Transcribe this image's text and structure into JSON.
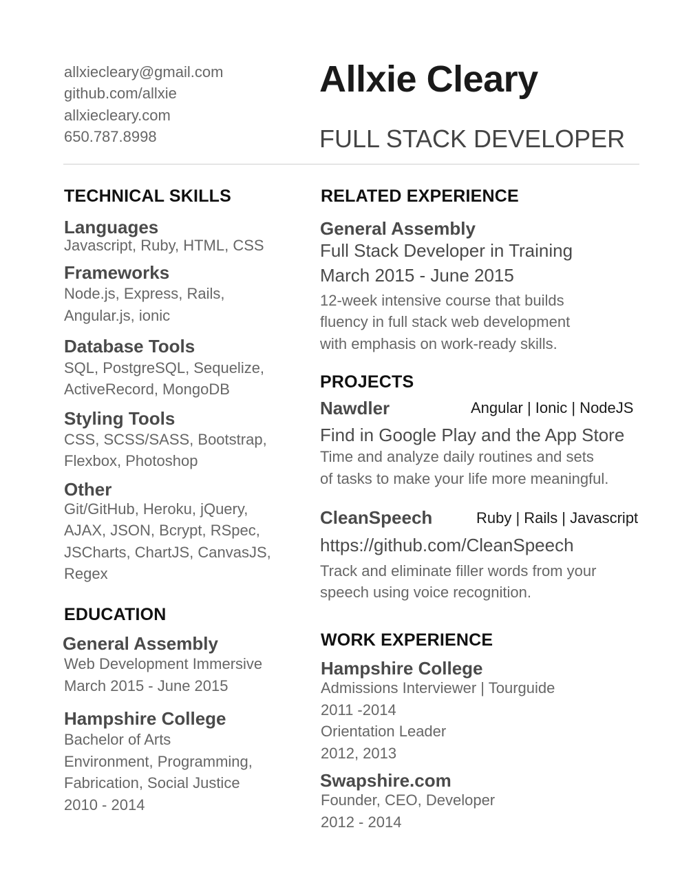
{
  "header": {
    "contact": [
      "allxiecleary@gmail.com",
      "github.com/allxie",
      "allxiecleary.com",
      "650.787.8998"
    ],
    "name": "Allxie Cleary",
    "role": "FULL STACK DEVELOPER"
  },
  "skills": {
    "heading": "TECHNICAL SKILLS",
    "groups": [
      {
        "title": "Languages",
        "lines": [
          "Javascript, Ruby, HTML, CSS"
        ]
      },
      {
        "title": "Frameworks",
        "lines": [
          "Node.js, Express, Rails,",
          "Angular.js, ionic"
        ]
      },
      {
        "title": "Database Tools",
        "lines": [
          "SQL, PostgreSQL, Sequelize,",
          "ActiveRecord, MongoDB"
        ]
      },
      {
        "title": "Styling Tools",
        "lines": [
          "CSS, SCSS/SASS, Bootstrap,",
          "Flexbox, Photoshop"
        ]
      },
      {
        "title": "Other",
        "lines": [
          "Git/GitHub, Heroku, jQuery,",
          "AJAX, JSON, Bcrypt, RSpec,",
          "JSCharts, ChartJS, CanvasJS,",
          "Regex"
        ]
      }
    ]
  },
  "education": {
    "heading": "EDUCATION",
    "entries": [
      {
        "school": "General Assembly",
        "lines": [
          "Web Development Immersive",
          "March 2015 - June 2015"
        ]
      },
      {
        "school": "Hampshire College",
        "lines": [
          "Bachelor of Arts",
          "Environment, Programming,",
          "Fabrication, Social Justice",
          "2010 - 2014"
        ]
      }
    ]
  },
  "related": {
    "heading": "RELATED EXPERIENCE",
    "org": "General Assembly",
    "title": "Full Stack Developer in Training",
    "dates": "March 2015 - June 2015",
    "desc": [
      "12-week intensive course that builds",
      "fluency in full stack web development",
      "with emphasis on work-ready skills."
    ]
  },
  "projects": {
    "heading": "PROJECTS",
    "items": [
      {
        "name": "Nawdler",
        "tech": "Angular | Ionic | NodeJS",
        "link": "Find in Google Play and the App Store",
        "desc": [
          "Time and analyze daily routines and sets",
          "of tasks to make your life more meaningful."
        ]
      },
      {
        "name": "CleanSpeech",
        "tech": "Ruby | Rails | Javascript",
        "link": "https://github.com/CleanSpeech",
        "desc": [
          "Track and eliminate filler words from your",
          "speech using voice recognition."
        ]
      }
    ]
  },
  "work": {
    "heading": "WORK EXPERIENCE",
    "entries": [
      {
        "org": "Hampshire College",
        "lines": [
          "Admissions Interviewer | Tourguide",
          "2011 -2014",
          "Orientation Leader",
          "2012, 2013"
        ]
      },
      {
        "org": "Swapshire.com",
        "lines": [
          "Founder, CEO, Developer",
          "2012 - 2014"
        ]
      }
    ]
  }
}
